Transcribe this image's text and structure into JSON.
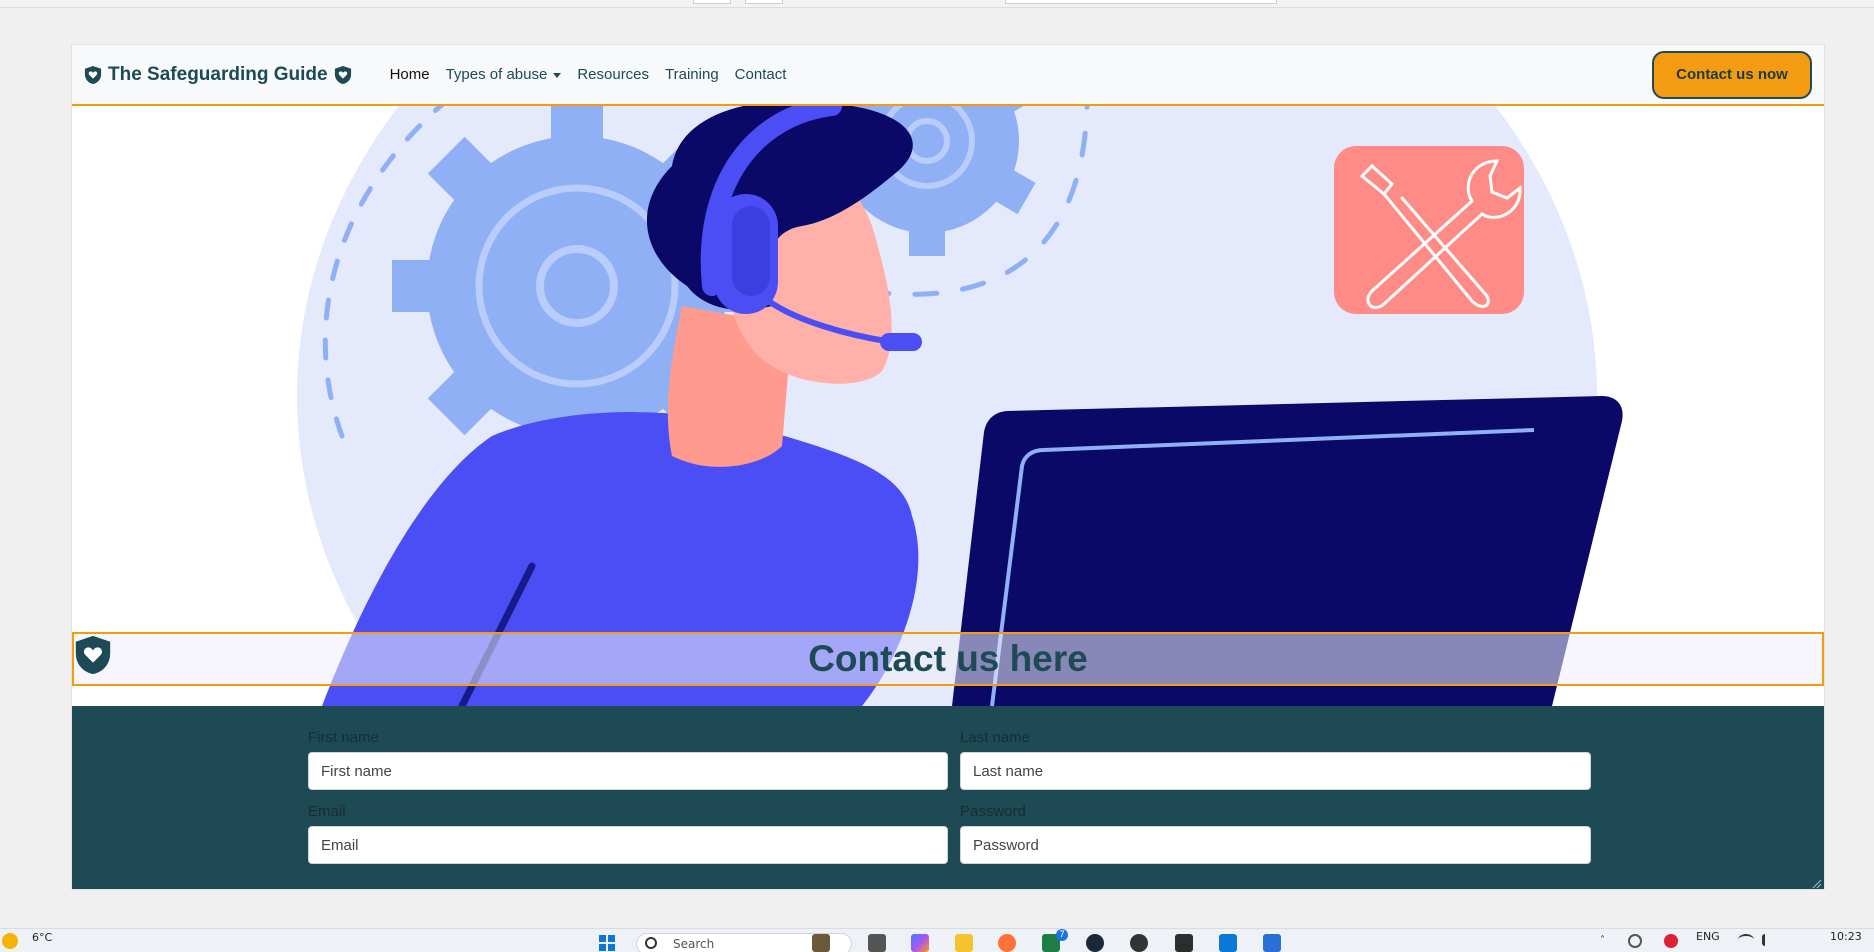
{
  "navbar": {
    "brand": "The Safeguarding Guide",
    "links": [
      {
        "label": "Home",
        "active": true
      },
      {
        "label": "Types of abuse",
        "dropdown": true
      },
      {
        "label": "Resources"
      },
      {
        "label": "Training"
      },
      {
        "label": "Contact"
      }
    ],
    "cta_label": "Contact us now"
  },
  "hero": {
    "heading": "Contact us here"
  },
  "form": {
    "first_name": {
      "label": "First name",
      "placeholder": "First name"
    },
    "last_name": {
      "label": "Last name",
      "placeholder": "Last name"
    },
    "email": {
      "label": "Email",
      "placeholder": "Email"
    },
    "password": {
      "label": "Password",
      "placeholder": "Password"
    }
  },
  "taskbar": {
    "weather": "6°C",
    "search_placeholder": "Search",
    "notification_count": "7",
    "language": "ENG",
    "time": "10:23"
  },
  "colors": {
    "brand_teal": "#1d4a55",
    "accent_orange": "#f39c12",
    "hero_blue": "#4b4ef5",
    "gear_blue": "#8fb0f5",
    "tools_red": "#ff8b87"
  }
}
